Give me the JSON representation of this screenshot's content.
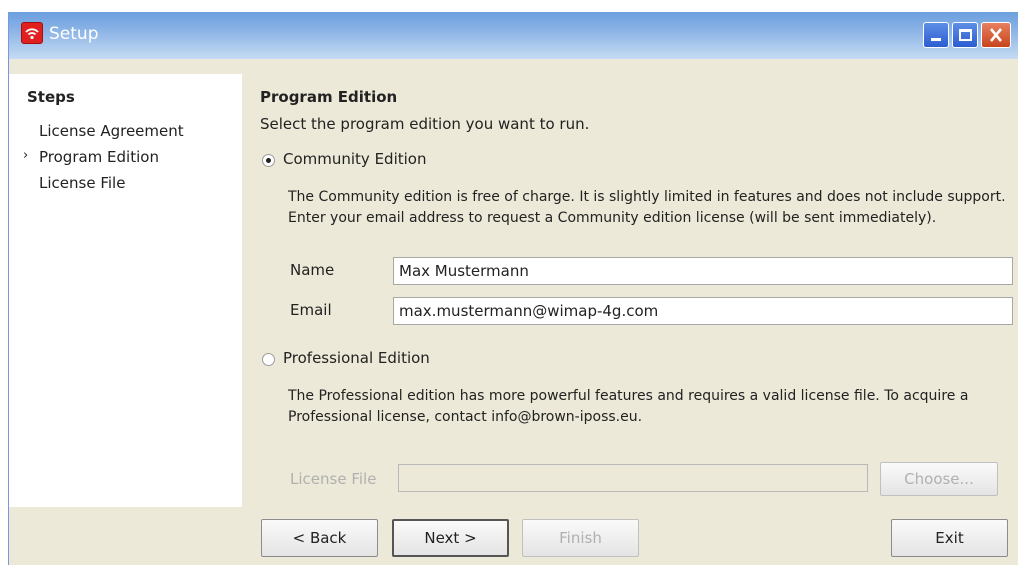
{
  "window": {
    "title": "Setup"
  },
  "steps": {
    "title": "Steps",
    "items": [
      {
        "label": "License Agreement",
        "current": false
      },
      {
        "label": "Program Edition",
        "current": true
      },
      {
        "label": "License File",
        "current": false
      }
    ],
    "current_marker": "›"
  },
  "main": {
    "heading": "Program Edition",
    "instruction": "Select the program edition you want to run.",
    "community": {
      "label": "Community Edition",
      "selected": true,
      "description": "The Community edition is free of charge. It is slightly limited in features and does not include support. Enter your email address to request a Community edition license (will be sent immediately).",
      "name_label": "Name",
      "name_value": "Max Mustermann",
      "email_label": "Email",
      "email_value": "max.mustermann@wimap-4g.com"
    },
    "professional": {
      "label": "Professional Edition",
      "selected": false,
      "description": "The Professional edition has more powerful features and requires a valid license file. To acquire a Professional license, contact info@brown-iposs.eu.",
      "license_file_label": "License File",
      "license_file_value": "",
      "choose_label": "Choose..."
    }
  },
  "footer": {
    "back_label": "< Back",
    "next_label": "Next >",
    "finish_label": "Finish",
    "exit_label": "Exit"
  }
}
